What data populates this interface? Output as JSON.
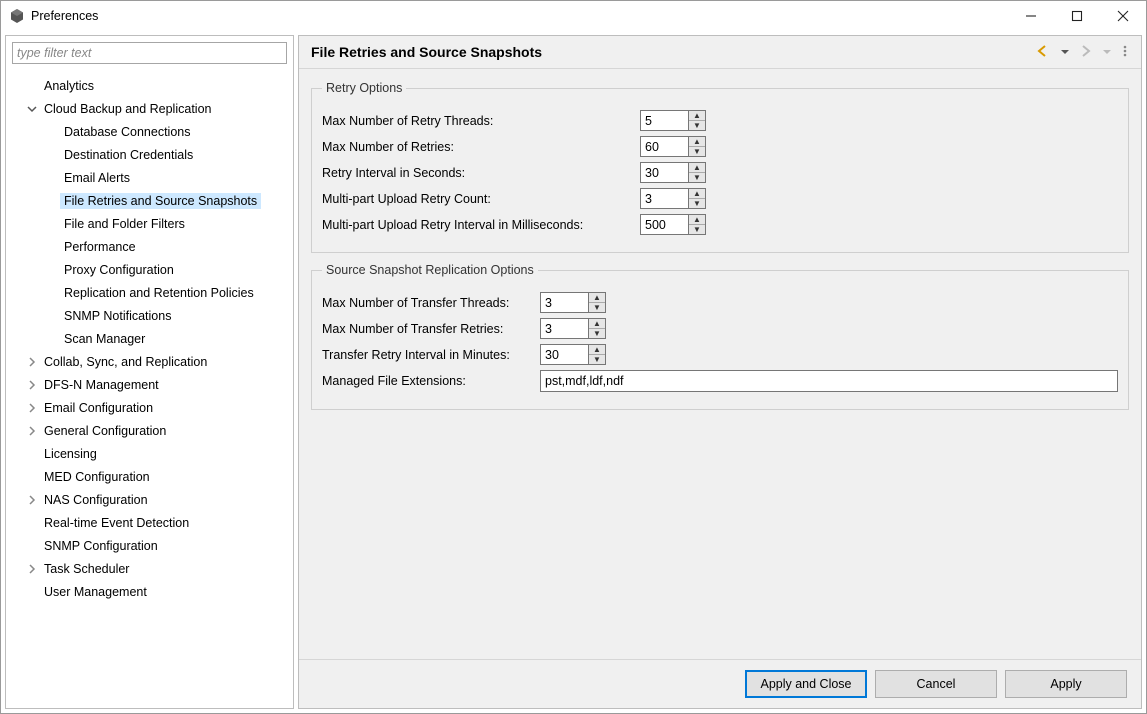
{
  "window": {
    "title": "Preferences"
  },
  "filter": {
    "placeholder": "type filter text"
  },
  "tree": [
    {
      "label": "Analytics",
      "level": 0,
      "twist": ""
    },
    {
      "label": "Cloud Backup and Replication",
      "level": 0,
      "twist": "open"
    },
    {
      "label": "Database Connections",
      "level": 1,
      "twist": ""
    },
    {
      "label": "Destination Credentials",
      "level": 1,
      "twist": ""
    },
    {
      "label": "Email Alerts",
      "level": 1,
      "twist": ""
    },
    {
      "label": "File Retries and Source Snapshots",
      "level": 1,
      "twist": "",
      "selected": true
    },
    {
      "label": "File and Folder Filters",
      "level": 1,
      "twist": ""
    },
    {
      "label": "Performance",
      "level": 1,
      "twist": ""
    },
    {
      "label": "Proxy Configuration",
      "level": 1,
      "twist": ""
    },
    {
      "label": "Replication and Retention Policies",
      "level": 1,
      "twist": ""
    },
    {
      "label": "SNMP Notifications",
      "level": 1,
      "twist": ""
    },
    {
      "label": "Scan Manager",
      "level": 1,
      "twist": ""
    },
    {
      "label": "Collab, Sync, and Replication",
      "level": 0,
      "twist": "closed"
    },
    {
      "label": "DFS-N Management",
      "level": 0,
      "twist": "closed"
    },
    {
      "label": "Email Configuration",
      "level": 0,
      "twist": "closed"
    },
    {
      "label": "General Configuration",
      "level": 0,
      "twist": "closed"
    },
    {
      "label": "Licensing",
      "level": 0,
      "twist": ""
    },
    {
      "label": "MED Configuration",
      "level": 0,
      "twist": ""
    },
    {
      "label": "NAS Configuration",
      "level": 0,
      "twist": "closed"
    },
    {
      "label": "Real-time Event Detection",
      "level": 0,
      "twist": ""
    },
    {
      "label": "SNMP Configuration",
      "level": 0,
      "twist": ""
    },
    {
      "label": "Task Scheduler",
      "level": 0,
      "twist": "closed"
    },
    {
      "label": "User Management",
      "level": 0,
      "twist": ""
    }
  ],
  "page": {
    "title": "File Retries and Source Snapshots",
    "retry": {
      "legend": "Retry Options",
      "fields": [
        {
          "label": "Max Number of Retry Threads:",
          "value": "5"
        },
        {
          "label": "Max Number of Retries:",
          "value": "60"
        },
        {
          "label": "Retry Interval in Seconds:",
          "value": "30"
        },
        {
          "label": "Multi-part Upload Retry Count:",
          "value": "3"
        },
        {
          "label": "Multi-part Upload Retry Interval in Milliseconds:",
          "value": "500"
        }
      ]
    },
    "ssr": {
      "legend": "Source Snapshot Replication Options",
      "fields": [
        {
          "label": "Max Number of Transfer Threads:",
          "value": "3"
        },
        {
          "label": "Max Number of Transfer Retries:",
          "value": "3"
        },
        {
          "label": "Transfer Retry Interval in Minutes:",
          "value": "30"
        }
      ],
      "ext_label": "Managed File Extensions:",
      "ext_value": "pst,mdf,ldf,ndf"
    }
  },
  "buttons": {
    "apply_close": "Apply and Close",
    "cancel": "Cancel",
    "apply": "Apply"
  }
}
